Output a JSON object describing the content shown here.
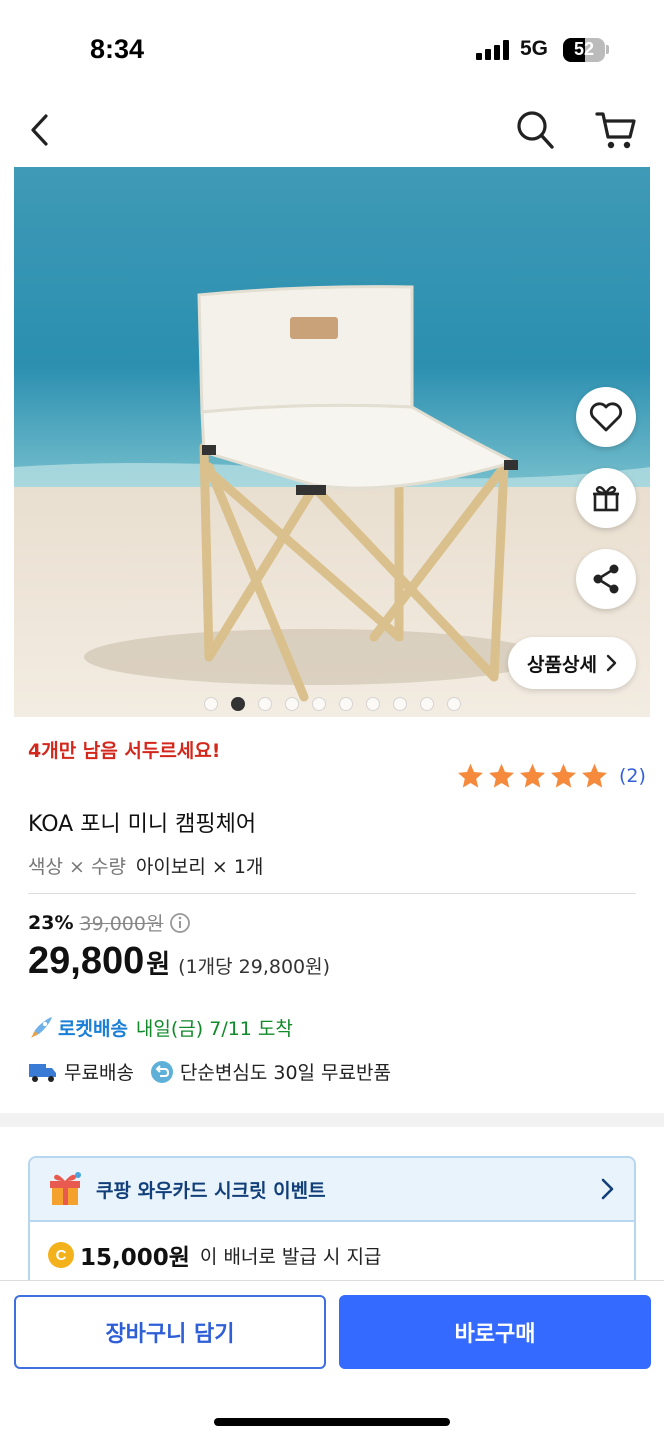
{
  "status_bar": {
    "time": "8:34",
    "network": "5G",
    "battery": "52",
    "battery_level": 0.52
  },
  "product_image": {
    "detail_label": "상품상세",
    "image_count": 10,
    "active_index": 1
  },
  "stock_notice": "4개만 남음 서두르세요!",
  "rating": {
    "stars": 5,
    "count": "(2)"
  },
  "product_title": "KOA 포니 미니 캠핑체어",
  "option": {
    "label": "색상 × 수량",
    "value": "아이보리 × 1개"
  },
  "pricing": {
    "discount_rate": "23%",
    "original_price": "39,000원",
    "price": "29,800",
    "price_unit": "원",
    "unit_price": "(1개당 29,800원)"
  },
  "delivery": {
    "rocket_label": "로켓배송",
    "eta": "내일(금) 7/11 도착",
    "free_shipping": "무료배송",
    "free_return": "단순변심도 30일 무료반품"
  },
  "event": {
    "title": "쿠팡 와우카드 시크릿 이벤트",
    "coin_symbol": "C",
    "amount": "15,000원",
    "description": "이 배너로 발급 시 지급"
  },
  "actions": {
    "cart_label": "장바구니 담기",
    "buy_label": "바로구매"
  },
  "colors": {
    "accent_blue": "#346aff",
    "stock_red": "#d4271b",
    "star_orange": "#f58a3c",
    "rocket_green": "#118a2a"
  },
  "icons": [
    "back-icon",
    "search-icon",
    "cart-icon",
    "heart-icon",
    "gift-icon",
    "share-icon",
    "chevron-right-icon",
    "rocket-icon",
    "truck-icon",
    "return-icon",
    "coin-icon"
  ]
}
